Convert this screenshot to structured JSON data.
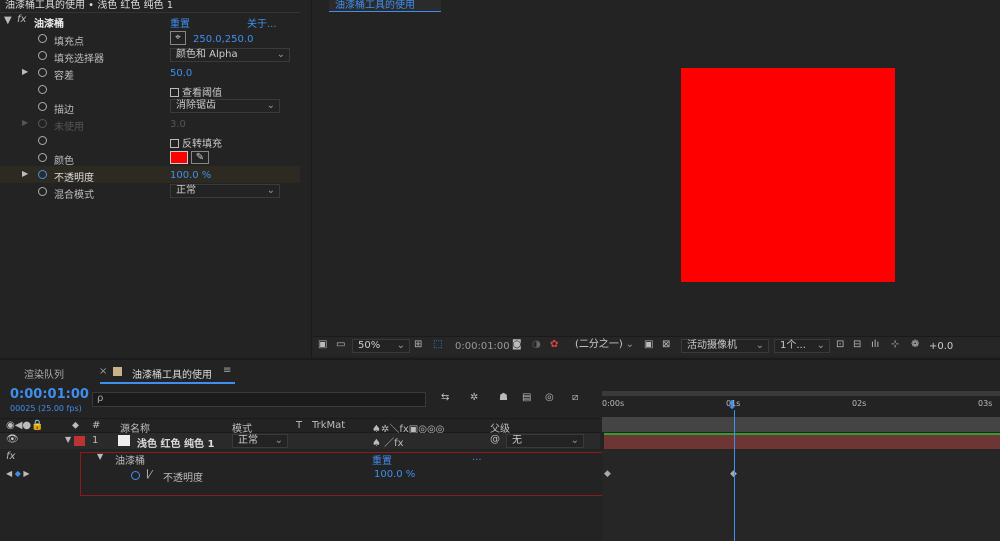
{
  "effect_panel": {
    "header": "油漆桶工具的使用 • 浅色 红色 纯色 1",
    "effect_name": "油漆桶",
    "reset": "重置",
    "about": "关于...",
    "rows": [
      {
        "label": "填充点",
        "value": "250.0,250.0"
      },
      {
        "label": "填充选择器",
        "value": "颜色和 Alpha"
      },
      {
        "label": "容差",
        "value": "50.0"
      },
      {
        "label": "",
        "value": "查看阈值"
      },
      {
        "label": "描边",
        "value": "消除锯齿"
      },
      {
        "label": "未使用",
        "value": "3.0"
      },
      {
        "label": "",
        "value": "反转填充"
      },
      {
        "label": "颜色",
        "value": ""
      },
      {
        "label": "不透明度",
        "value": "100.0 %"
      },
      {
        "label": "混合模式",
        "value": "正常"
      }
    ],
    "fill_color": "#ff0000"
  },
  "comp_viewer": {
    "tab": "油漆桶工具的使用",
    "square_color": "#ff0000",
    "toolbar": {
      "zoom": "50%",
      "timecode": "0:00:01:00",
      "resolution": "(二分之一)",
      "camera": "活动摄像机",
      "views": "1个...",
      "exposure": "+0.0"
    }
  },
  "timeline": {
    "tabs": [
      "渲染队列",
      "油漆桶工具的使用"
    ],
    "timecode": "0:00:01:00",
    "frame_info": "00025 (25.00 fps)",
    "search_placeholder": "ρ",
    "columns": {
      "num": "#",
      "source": "源名称",
      "mode": "模式",
      "t": "T",
      "trkmat": "TrkMat",
      "parent": "父级"
    },
    "layer": {
      "index": "1",
      "name": "浅色 红色 纯色 1",
      "mode": "正常",
      "parent": "无"
    },
    "effect_row": {
      "name": "油漆桶",
      "reset": "重置",
      "more": "..."
    },
    "prop_row": {
      "name": "不透明度",
      "value": "100.0 %"
    },
    "ruler": [
      "0:00s",
      "01s",
      "02s",
      "03s"
    ]
  }
}
